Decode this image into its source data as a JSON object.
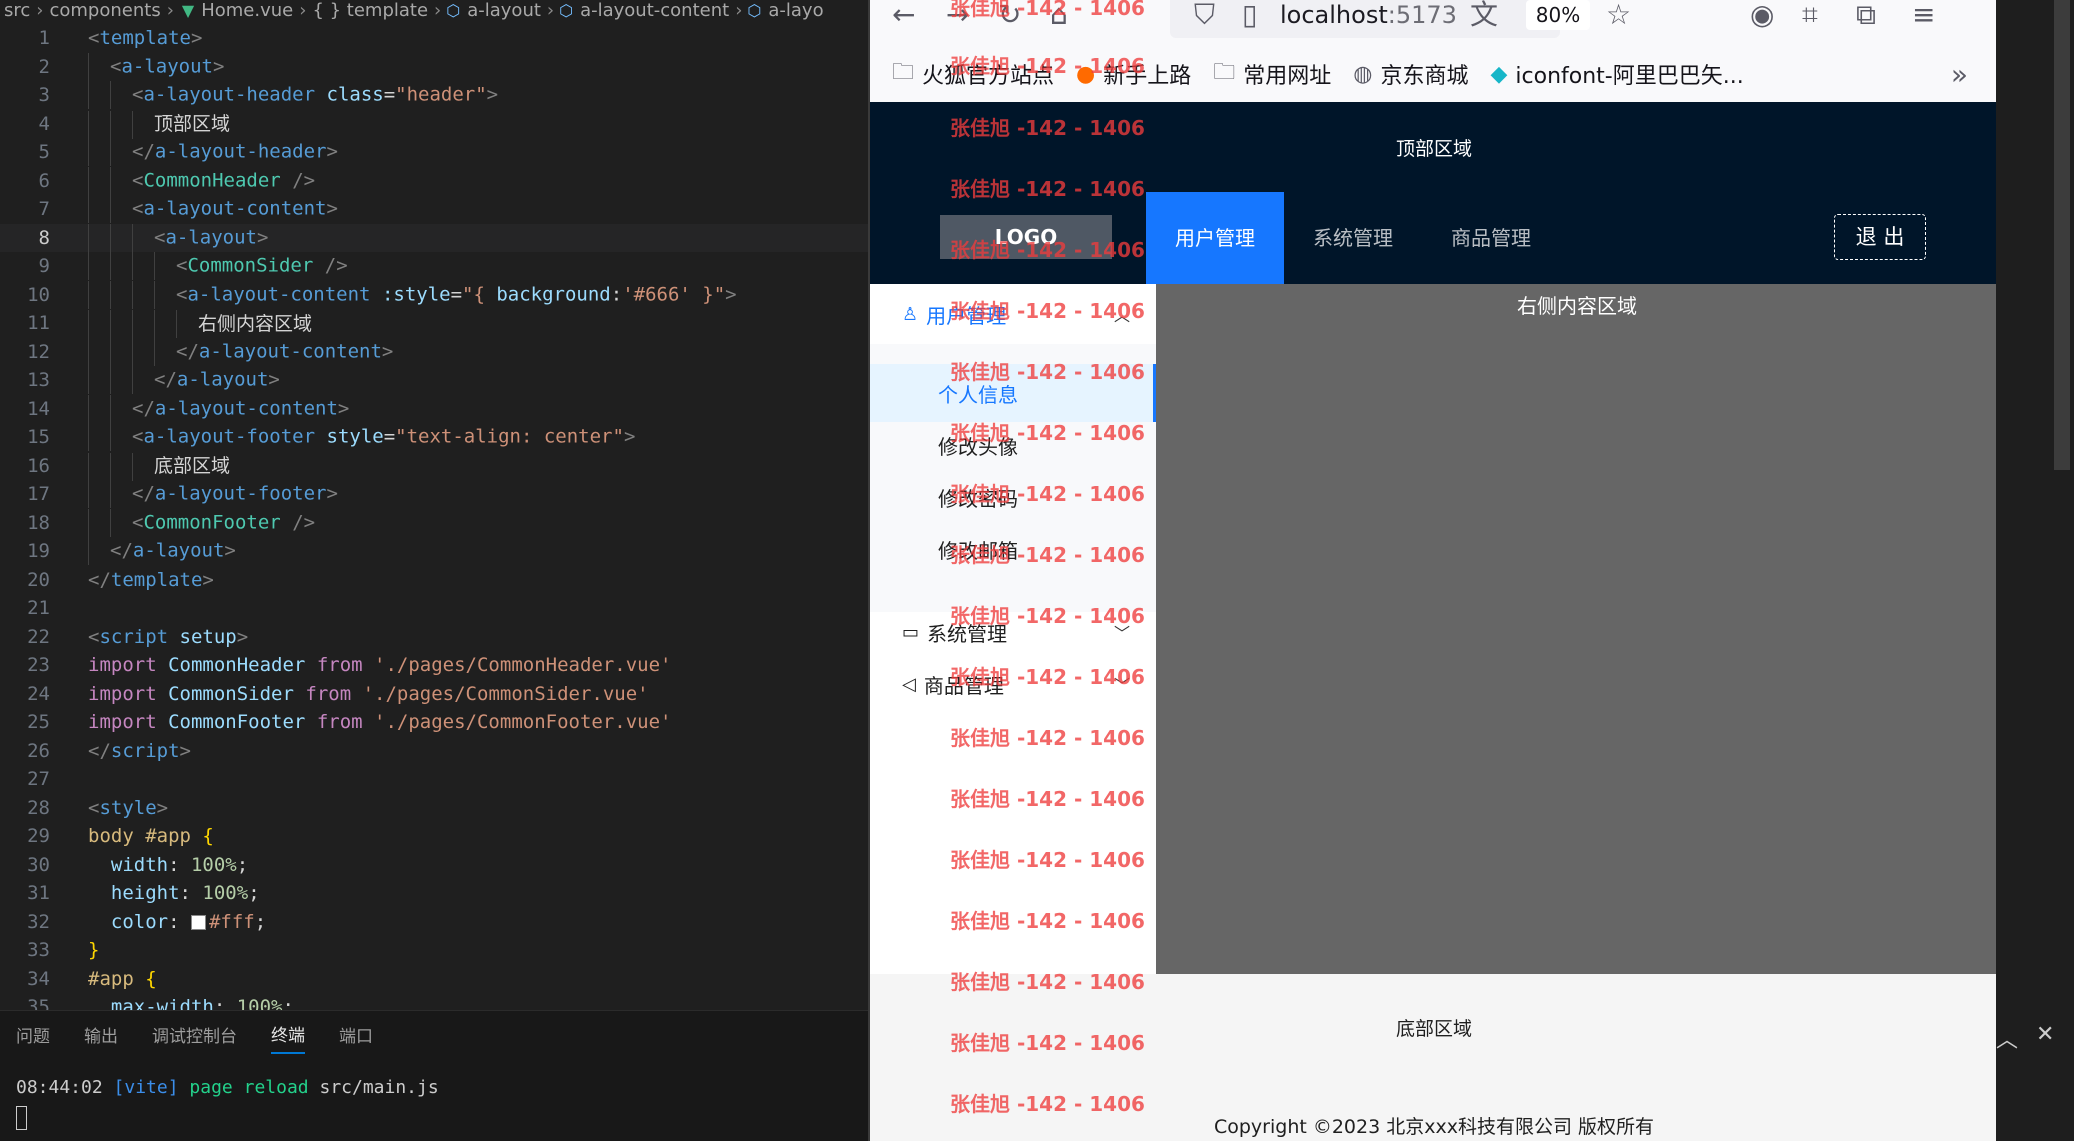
{
  "editor": {
    "breadcrumb": [
      "src",
      "components",
      "Home.vue",
      "{ } template",
      "a-layout",
      "a-layout-content",
      "a-layo"
    ],
    "active_line": 8,
    "line_numbers": [
      "1",
      "2",
      "3",
      "4",
      "5",
      "6",
      "7",
      "8",
      "9",
      "10",
      "11",
      "12",
      "13",
      "14",
      "15",
      "16",
      "17",
      "18",
      "19",
      "20",
      "21",
      "22",
      "23",
      "24",
      "25",
      "26",
      "27",
      "28",
      "29",
      "30",
      "31",
      "32",
      "33",
      "34",
      "35"
    ],
    "code": {
      "l1_tag": "template",
      "l2_tag": "a-layout",
      "l3_tag": "a-layout-header",
      "l3_attr": "class",
      "l3_val": "\"header\"",
      "l4_text": "顶部区域",
      "l5_tag": "a-layout-header",
      "l6_comp": "CommonHeader",
      "l7_tag": "a-layout-content",
      "l8_tag": "a-layout",
      "l9_comp": "CommonSider",
      "l10_tag": "a-layout-content",
      "l10_attr": ":style",
      "l10_pre": "\"{ ",
      "l10_prop": "background",
      "l10_colon": ":",
      "l10_str": "'#666'",
      "l10_post": " }\"",
      "l11_text": "右侧内容区域",
      "l12_tag": "a-layout-content",
      "l13_tag": "a-layout",
      "l14_tag": "a-layout-content",
      "l15_tag": "a-layout-footer",
      "l15_attr": "style",
      "l15_val": "\"text-align: center\"",
      "l16_text": "底部区域",
      "l17_tag": "a-layout-footer",
      "l18_comp": "CommonFooter",
      "l19_tag": "a-layout",
      "l20_tag": "template",
      "l22_tag": "script",
      "l22_attr": "setup",
      "import_kw": "import",
      "from_kw": "from",
      "l23_name": "CommonHeader",
      "l23_path": "'./pages/CommonHeader.vue'",
      "l24_name": "CommonSider",
      "l24_path": "'./pages/CommonSider.vue'",
      "l25_name": "CommonFooter",
      "l25_path": "'./pages/CommonFooter.vue'",
      "l26_tag": "script",
      "l28_tag": "style",
      "l29_sel": "body #app",
      "l30_prop": "width",
      "l30_val": "100%",
      "l31_prop": "height",
      "l31_val": "100%",
      "l32_prop": "color",
      "l32_val": "#fff",
      "l34_sel": "#app",
      "l35_prop": "max-width",
      "l35_val": "100%"
    }
  },
  "panel": {
    "tabs": [
      "问题",
      "输出",
      "调试控制台",
      "终端",
      "端口"
    ],
    "active_tab": "终端",
    "terminal": {
      "time": "08:44:02",
      "tag": "[vite]",
      "msg": "page reload",
      "file": "src/main.js"
    }
  },
  "browser": {
    "url_host": "localhost",
    "url_port": ":5173",
    "zoom": "80%",
    "bookmarks": [
      {
        "label": "火狐官方站点",
        "icon": "folder-icon"
      },
      {
        "label": "新手上路",
        "icon": "firefox-icon"
      },
      {
        "label": "常用网址",
        "icon": "folder-icon"
      },
      {
        "label": "京东商城",
        "icon": "globe-icon"
      },
      {
        "label": "iconfont-阿里巴巴矢...",
        "icon": "iconfont-icon"
      }
    ]
  },
  "app": {
    "header_region": "顶部区域",
    "logo": "LOGO",
    "menu": [
      "用户管理",
      "系统管理",
      "商品管理"
    ],
    "active_menu": "用户管理",
    "logout": "退 出",
    "sider": {
      "user_mgmt": "用户管理",
      "items": [
        "个人信息",
        "修改头像",
        "修改密码",
        "修改邮箱"
      ],
      "selected": "个人信息",
      "system_mgmt": "系统管理",
      "product_mgmt": "商品管理"
    },
    "content_text": "右侧内容区域",
    "footer_region": "底部区域",
    "copyright": "Copyright ©2023 北京xxx科技有限公司 版权所有",
    "watermark": "张佳旭 -142 - 1406"
  },
  "colors": {
    "header_bg": "#001529",
    "menu_active": "#1677ff",
    "content_bg": "#666666",
    "watermark": "#ee3c3c"
  }
}
